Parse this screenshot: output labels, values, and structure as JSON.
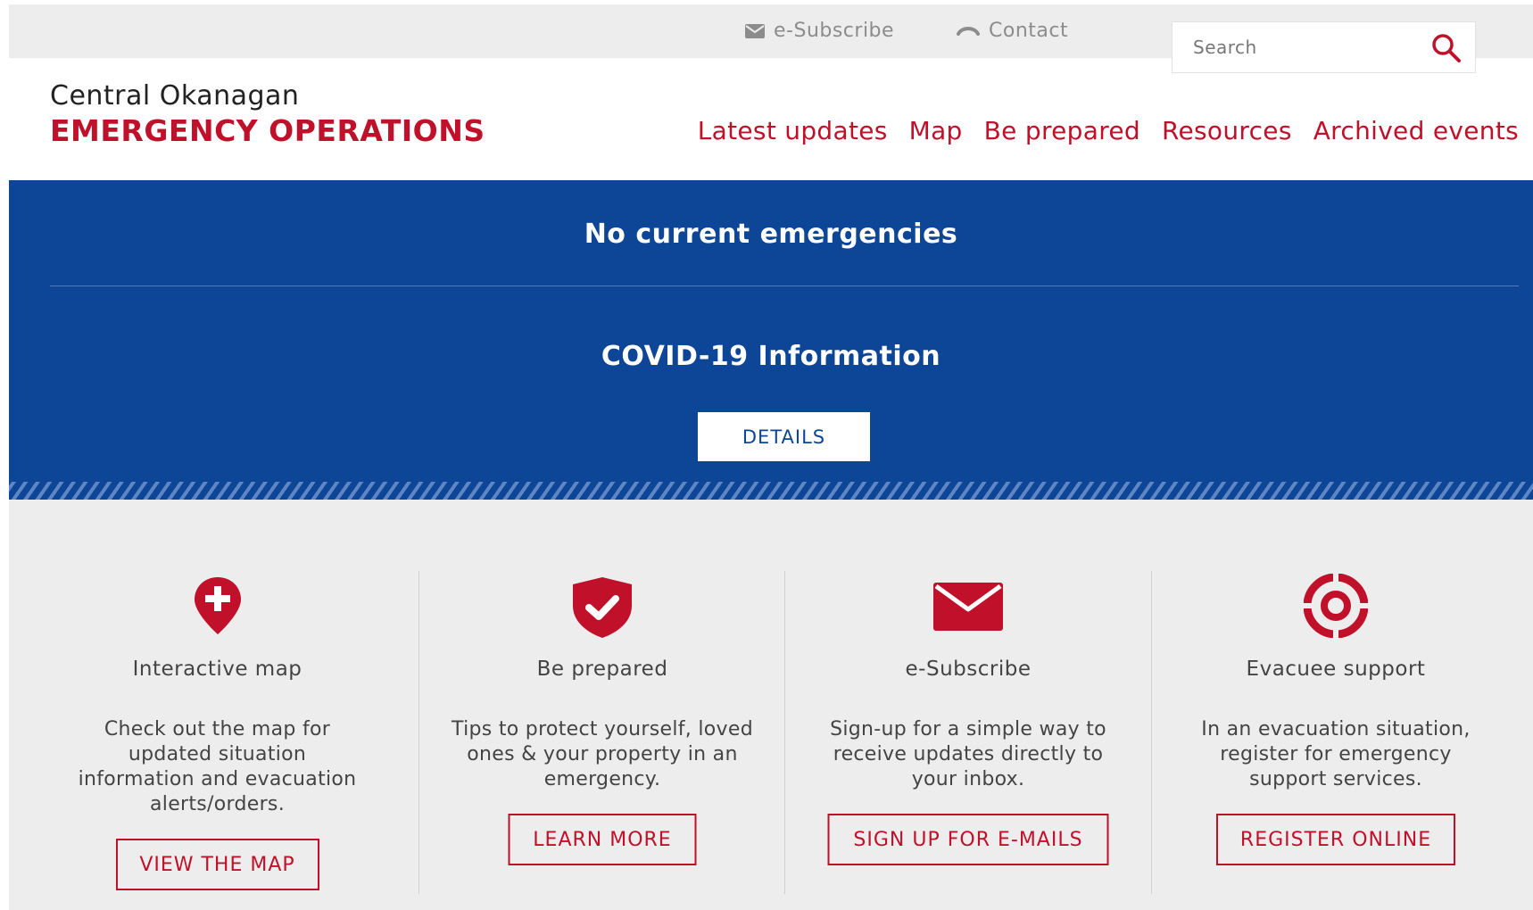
{
  "utility": {
    "subscribe_label": "e-Subscribe",
    "contact_label": "Contact",
    "search_placeholder": "Search"
  },
  "brand": {
    "line1": "Central Okanagan",
    "line2": "EMERGENCY OPERATIONS"
  },
  "nav": [
    "Latest updates",
    "Map",
    "Be prepared",
    "Resources",
    "Archived events"
  ],
  "banner": {
    "title": "No current emergencies",
    "subtitle": "COVID-19 Information",
    "button": "DETAILS"
  },
  "cards": [
    {
      "icon": "map-pin-plus-icon",
      "title": "Interactive map",
      "desc": "Check out the map for updated situation information and evacuation alerts/orders.",
      "button": "VIEW THE MAP"
    },
    {
      "icon": "shield-check-icon",
      "title": "Be prepared",
      "desc": "Tips to protect yourself, loved ones & your property in an emergency.",
      "button": "LEARN MORE"
    },
    {
      "icon": "envelope-icon",
      "title": "e-Subscribe",
      "desc": "Sign-up for a simple way to receive updates directly to your inbox.",
      "button": "SIGN UP FOR E-MAILS"
    },
    {
      "icon": "lifebuoy-icon",
      "title": "Evacuee support",
      "desc": "In an evacuation situation, register for emergency support services.",
      "button": "REGISTER ONLINE"
    }
  ],
  "colors": {
    "brand_red": "#c0102a",
    "banner_blue": "#0d4597",
    "utility_gray": "#ededed"
  }
}
